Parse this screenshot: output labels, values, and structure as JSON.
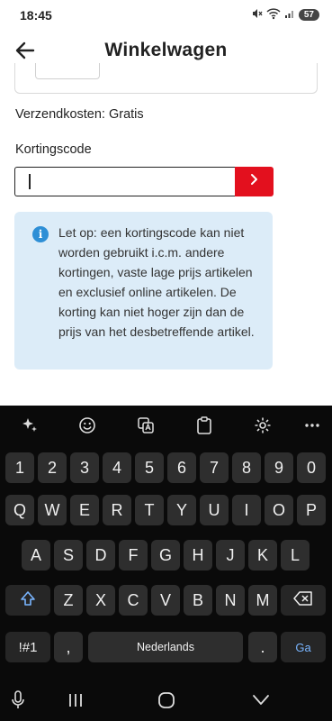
{
  "status_bar": {
    "time": "18:45",
    "battery": "57"
  },
  "header": {
    "title": "Winkelwagen",
    "back_icon": "arrow-left-icon"
  },
  "cart": {
    "shipping_text": "Verzendkosten: Gratis",
    "discount_label": "Kortingscode",
    "discount_value": "",
    "submit_icon": "chevron-right-icon",
    "notice_icon": "info-icon",
    "notice_text": "Let op: een kortingscode kan niet worden gebruikt i.c.m. andere kortingen, vaste lage prijs artikelen en exclusief online artikelen. De korting kan niet hoger zijn dan de prijs van het desbetreffende artikel."
  },
  "keyboard": {
    "toolbar": [
      "sparkle-icon",
      "emoji-icon",
      "translate-icon",
      "clipboard-icon",
      "settings-icon",
      "more-icon"
    ],
    "number_row": [
      "1",
      "2",
      "3",
      "4",
      "5",
      "6",
      "7",
      "8",
      "9",
      "0"
    ],
    "row1": [
      "Q",
      "W",
      "E",
      "R",
      "T",
      "Y",
      "U",
      "I",
      "O",
      "P"
    ],
    "row2": [
      "A",
      "S",
      "D",
      "F",
      "G",
      "H",
      "J",
      "K",
      "L"
    ],
    "row3": [
      "Z",
      "X",
      "C",
      "V",
      "B",
      "N",
      "M"
    ],
    "symbols_label": "!#1",
    "comma_label": ",",
    "space_label": "Nederlands",
    "period_label": ".",
    "action_label": "Ga"
  },
  "navigation": [
    "keyboard-mic-icon",
    "recents-icon",
    "home-icon",
    "back-down-icon"
  ],
  "colors": {
    "accent_red": "#e3101e",
    "notice_bg": "#dcecf8",
    "info_blue": "#2e8fd6",
    "keyboard_bg": "#0a0a0a",
    "key_bg": "#2e2e2e"
  }
}
